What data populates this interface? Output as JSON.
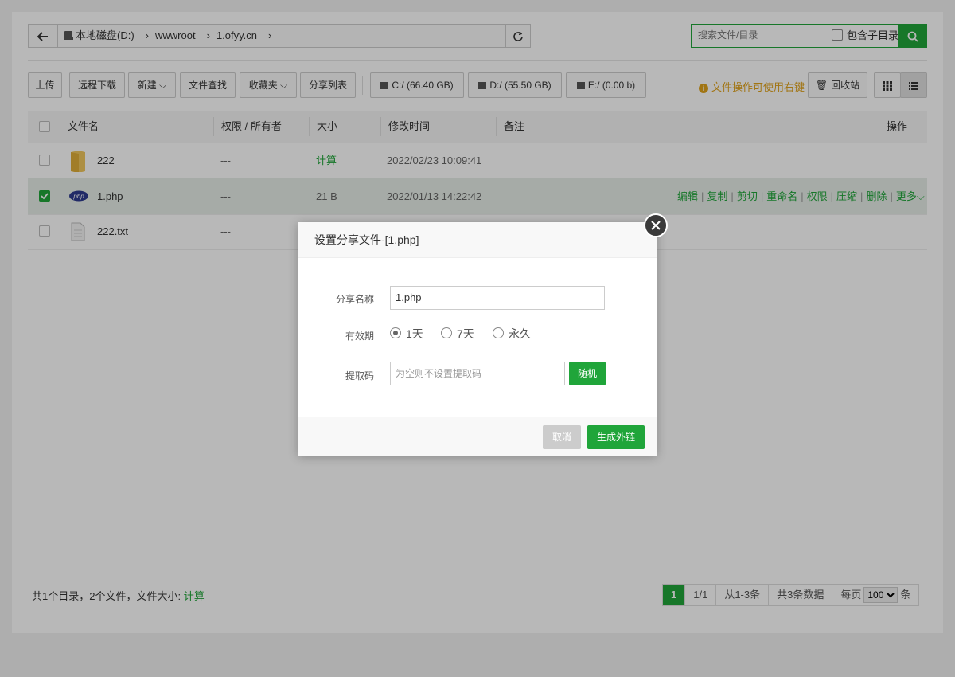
{
  "address": {
    "crumbs": [
      "本地磁盘(D:)",
      "wwwroot",
      "1.ofyy.cn"
    ]
  },
  "search": {
    "placeholder": "搜索文件/目录",
    "subdir_label": "包含子目录"
  },
  "toolbar": {
    "upload": "上传",
    "remote_download": "远程下载",
    "new": "新建",
    "file_search": "文件查找",
    "favorites": "收藏夹",
    "share_list": "分享列表",
    "drive_c": "C:/ (66.40 GB)",
    "drive_d": "D:/ (55.50 GB)",
    "drive_e": "E:/ (0.00 b)",
    "hint": "文件操作可使用右键",
    "recycle": "回收站"
  },
  "table": {
    "headers": {
      "name": "文件名",
      "perm": "权限 / 所有者",
      "size": "大小",
      "mtime": "修改时间",
      "note": "备注",
      "ops": "操作"
    },
    "rows": [
      {
        "name": "222",
        "perm": "---",
        "size": "计算",
        "mtime": "2022/02/23 10:09:41",
        "checked": false,
        "icon": "folder-icon"
      },
      {
        "name": "1.php",
        "perm": "---",
        "size": "21 B",
        "mtime": "2022/01/13 14:22:42",
        "checked": true,
        "icon": "php-file-icon"
      },
      {
        "name": "222.txt",
        "perm": "---",
        "size": "",
        "mtime": "",
        "checked": false,
        "icon": "text-file-icon"
      }
    ],
    "row_ops": [
      "编辑",
      "复制",
      "剪切",
      "重命名",
      "权限",
      "压缩",
      "删除",
      "更多"
    ]
  },
  "footer": {
    "summary": "共1个目录，2个文件，文件大小:",
    "calc": "计算"
  },
  "pager": {
    "current": "1",
    "pages": "1/1",
    "range": "从1-3条",
    "total": "共3条数据",
    "per_page_label": "每页",
    "per_page_value": "100",
    "per_page_unit": "条"
  },
  "modal": {
    "title": "设置分享文件-[1.php]",
    "share_name_label": "分享名称",
    "share_name_value": "1.php",
    "validity_label": "有效期",
    "validity_options": [
      "1天",
      "7天",
      "永久"
    ],
    "validity_selected": "1天",
    "code_label": "提取码",
    "code_placeholder": "为空则不设置提取码",
    "random_btn": "随机",
    "cancel_btn": "取消",
    "generate_btn": "生成外链"
  },
  "colors": {
    "accent": "#20a53a",
    "hint": "#e0a21b"
  }
}
